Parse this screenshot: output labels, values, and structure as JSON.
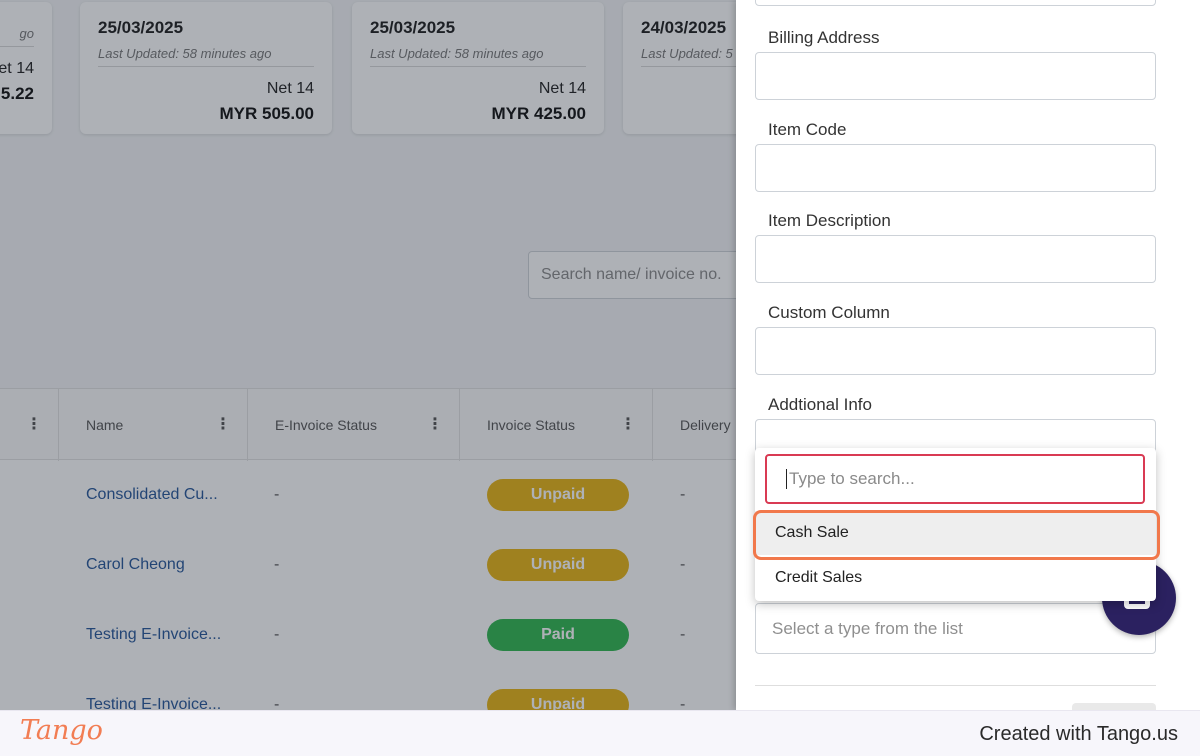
{
  "cards": [
    {
      "date": "",
      "updated": "go",
      "terms": "et 14",
      "amount": "5.22"
    },
    {
      "date": "25/03/2025",
      "updated": "Last Updated: 58 minutes ago",
      "terms": "Net 14",
      "amount": "MYR 505.00"
    },
    {
      "date": "25/03/2025",
      "updated": "Last Updated: 58 minutes ago",
      "terms": "Net 14",
      "amount": "MYR 425.00"
    },
    {
      "date": "24/03/2025",
      "updated": "Last Updated: 5",
      "terms": "",
      "amount": ""
    }
  ],
  "search": {
    "placeholder": "Search name/ invoice no."
  },
  "table": {
    "headers": [
      "Name",
      "E-Invoice Status",
      "Invoice Status",
      "Delivery"
    ],
    "rows": [
      {
        "name": "Consolidated Cu...",
        "einvoice": "-",
        "status": "Unpaid",
        "delivery": "-"
      },
      {
        "name": "Carol Cheong",
        "einvoice": "-",
        "status": "Unpaid",
        "delivery": "-"
      },
      {
        "name": "Testing E-Invoice...",
        "einvoice": "-",
        "status": "Paid",
        "delivery": "-"
      },
      {
        "name": "Testing E-Invoice...",
        "einvoice": "-",
        "status": "Unpaid",
        "delivery": "-"
      }
    ]
  },
  "panel": {
    "fields": [
      "Billing Address",
      "Item Code",
      "Item Description",
      "Custom Column",
      "Addtional Info"
    ],
    "select_placeholder": "Select a type from the list",
    "dropdown": {
      "search_placeholder": "Type to search...",
      "options": [
        "Cash Sale",
        "Credit Sales"
      ]
    }
  },
  "footer": {
    "logo": "Tango",
    "credit": "Created with Tango.us"
  },
  "colors": {
    "unpaid": "#e8b514",
    "paid": "#2fb84f",
    "highlight": "#f1784b",
    "search_border": "#d93a53",
    "fab": "#2b2160"
  }
}
